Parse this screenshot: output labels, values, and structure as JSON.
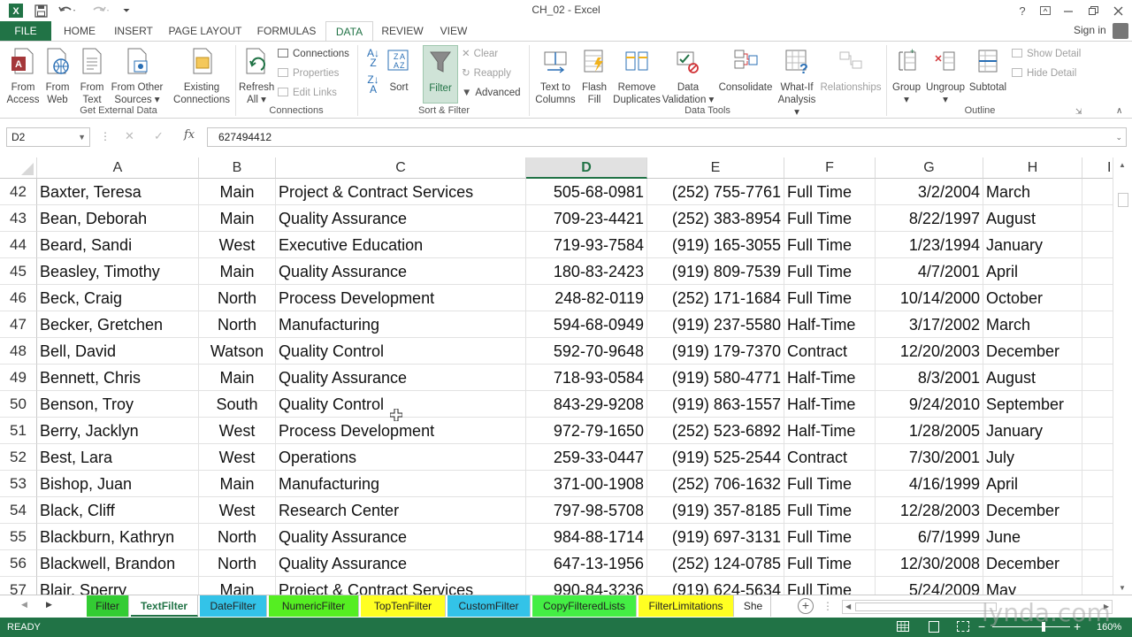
{
  "window": {
    "title": "CH_02 - Excel",
    "help": "?",
    "sign_in": "Sign in"
  },
  "tabs": [
    "FILE",
    "HOME",
    "INSERT",
    "PAGE LAYOUT",
    "FORMULAS",
    "DATA",
    "REVIEW",
    "VIEW"
  ],
  "active_tab": "DATA",
  "ribbon": {
    "get_external": {
      "from_access": [
        "From",
        "Access"
      ],
      "from_web": [
        "From",
        "Web"
      ],
      "from_text": [
        "From",
        "Text"
      ],
      "from_other": [
        "From Other",
        "Sources ▾"
      ],
      "existing": [
        "Existing",
        "Connections"
      ],
      "label": "Get External Data"
    },
    "connections": {
      "refresh": [
        "Refresh",
        "All ▾"
      ],
      "connections": "Connections",
      "properties": "Properties",
      "edit_links": "Edit Links",
      "label": "Connections"
    },
    "sort_filter": {
      "sort": "Sort",
      "filter": "Filter",
      "clear": "Clear",
      "reapply": "Reapply",
      "advanced": "Advanced",
      "label": "Sort & Filter"
    },
    "data_tools": {
      "text_to_columns": [
        "Text to",
        "Columns"
      ],
      "flash_fill": [
        "Flash",
        "Fill"
      ],
      "remove_duplicates": [
        "Remove",
        "Duplicates"
      ],
      "data_validation": [
        "Data",
        "Validation ▾"
      ],
      "consolidate": "Consolidate",
      "what_if": [
        "What-If",
        "Analysis ▾"
      ],
      "relationships": "Relationships",
      "label": "Data Tools"
    },
    "outline": {
      "group": [
        "Group",
        "▾"
      ],
      "ungroup": [
        "Ungroup",
        "▾"
      ],
      "subtotal": "Subtotal",
      "show_detail": "Show Detail",
      "hide_detail": "Hide Detail",
      "label": "Outline"
    }
  },
  "formula_bar": {
    "name_box": "D2",
    "fx": "fx",
    "value": "627494412"
  },
  "columns": [
    "A",
    "B",
    "C",
    "D",
    "E",
    "F",
    "G",
    "H",
    "I"
  ],
  "selected_column": "D",
  "rows": [
    {
      "n": "42",
      "a": "Baxter, Teresa",
      "b": "Main",
      "c": "Project & Contract Services",
      "d": "505-68-0981",
      "e": "(252) 755-7761",
      "f": "Full Time",
      "g": "3/2/2004",
      "h": "March"
    },
    {
      "n": "43",
      "a": "Bean, Deborah",
      "b": "Main",
      "c": "Quality Assurance",
      "d": "709-23-4421",
      "e": "(252) 383-8954",
      "f": "Full Time",
      "g": "8/22/1997",
      "h": "August"
    },
    {
      "n": "44",
      "a": "Beard, Sandi",
      "b": "West",
      "c": "Executive Education",
      "d": "719-93-7584",
      "e": "(919) 165-3055",
      "f": "Full Time",
      "g": "1/23/1994",
      "h": "January"
    },
    {
      "n": "45",
      "a": "Beasley, Timothy",
      "b": "Main",
      "c": "Quality Assurance",
      "d": "180-83-2423",
      "e": "(919) 809-7539",
      "f": "Full Time",
      "g": "4/7/2001",
      "h": "April"
    },
    {
      "n": "46",
      "a": "Beck, Craig",
      "b": "North",
      "c": "Process Development",
      "d": "248-82-0119",
      "e": "(252) 171-1684",
      "f": "Full Time",
      "g": "10/14/2000",
      "h": "October"
    },
    {
      "n": "47",
      "a": "Becker, Gretchen",
      "b": "North",
      "c": "Manufacturing",
      "d": "594-68-0949",
      "e": "(919) 237-5580",
      "f": "Half-Time",
      "g": "3/17/2002",
      "h": "March"
    },
    {
      "n": "48",
      "a": "Bell, David",
      "b": "Watson",
      "c": "Quality Control",
      "d": "592-70-9648",
      "e": "(919) 179-7370",
      "f": "Contract",
      "g": "12/20/2003",
      "h": "December"
    },
    {
      "n": "49",
      "a": "Bennett, Chris",
      "b": "Main",
      "c": "Quality Assurance",
      "d": "718-93-0584",
      "e": "(919) 580-4771",
      "f": "Half-Time",
      "g": "8/3/2001",
      "h": "August"
    },
    {
      "n": "50",
      "a": "Benson, Troy",
      "b": "South",
      "c": "Quality Control",
      "d": "843-29-9208",
      "e": "(919) 863-1557",
      "f": "Half-Time",
      "g": "9/24/2010",
      "h": "September"
    },
    {
      "n": "51",
      "a": "Berry, Jacklyn",
      "b": "West",
      "c": "Process Development",
      "d": "972-79-1650",
      "e": "(252) 523-6892",
      "f": "Half-Time",
      "g": "1/28/2005",
      "h": "January"
    },
    {
      "n": "52",
      "a": "Best, Lara",
      "b": "West",
      "c": "Operations",
      "d": "259-33-0447",
      "e": "(919) 525-2544",
      "f": "Contract",
      "g": "7/30/2001",
      "h": "July"
    },
    {
      "n": "53",
      "a": "Bishop, Juan",
      "b": "Main",
      "c": "Manufacturing",
      "d": "371-00-1908",
      "e": "(252) 706-1632",
      "f": "Full Time",
      "g": "4/16/1999",
      "h": "April"
    },
    {
      "n": "54",
      "a": "Black, Cliff",
      "b": "West",
      "c": "Research Center",
      "d": "797-98-5708",
      "e": "(919) 357-8185",
      "f": "Full Time",
      "g": "12/28/2003",
      "h": "December"
    },
    {
      "n": "55",
      "a": "Blackburn, Kathryn",
      "b": "North",
      "c": "Quality Assurance",
      "d": "984-88-1714",
      "e": "(919) 697-3131",
      "f": "Full Time",
      "g": "6/7/1999",
      "h": "June"
    },
    {
      "n": "56",
      "a": "Blackwell, Brandon",
      "b": "North",
      "c": "Quality Assurance",
      "d": "647-13-1956",
      "e": "(252) 124-0785",
      "f": "Full Time",
      "g": "12/30/2008",
      "h": "December"
    },
    {
      "n": "57",
      "a": "Blair, Sperry",
      "b": "Main",
      "c": "Project & Contract Services",
      "d": "990-84-3236",
      "e": "(919) 624-5634",
      "f": "Full Time",
      "g": "5/24/2009",
      "h": "May"
    }
  ],
  "sheets": [
    {
      "name": "Filter",
      "color": "#33cc33",
      "text": "#222222"
    },
    {
      "name": "TextFilter",
      "color": "#ffffff",
      "text": "#217346",
      "active": true
    },
    {
      "name": "DateFilter",
      "color": "#33c3e8",
      "text": "#222222"
    },
    {
      "name": "NumericFilter",
      "color": "#55ee22",
      "text": "#222222"
    },
    {
      "name": "TopTenFilter",
      "color": "#ffff22",
      "text": "#222222"
    },
    {
      "name": "CustomFilter",
      "color": "#33c3e8",
      "text": "#222222"
    },
    {
      "name": "CopyFilteredLists",
      "color": "#44ee44",
      "text": "#222222"
    },
    {
      "name": "FilterLimitations",
      "color": "#ffff22",
      "text": "#222222"
    },
    {
      "name": "She",
      "color": "#ffffff",
      "text": "#222222"
    }
  ],
  "status": {
    "ready": "READY",
    "zoom": "160%"
  },
  "watermark": "lynda.com",
  "colors": {
    "excel_green": "#217346",
    "filter_active": "#cfe3d7"
  }
}
